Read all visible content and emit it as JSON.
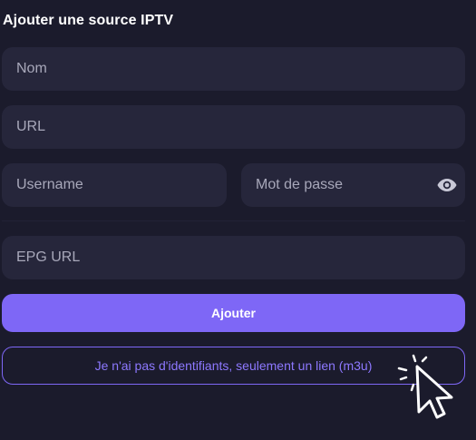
{
  "form": {
    "title": "Ajouter une source IPTV",
    "name_placeholder": "Nom",
    "url_placeholder": "URL",
    "username_placeholder": "Username",
    "password_placeholder": "Mot de passe",
    "epg_placeholder": "EPG URL",
    "submit_label": "Ajouter",
    "m3u_link_label": "Je n'ai pas d'identifiants, seulement un lien (m3u)"
  },
  "icons": {
    "password_toggle": "eye-icon",
    "pointer": "hand-pointer-click-icon"
  },
  "colors": {
    "background": "#1b1b2c",
    "field": "#26263b",
    "accent": "#7e67f6",
    "text": "#ffffff",
    "placeholder": "#a8a8ba"
  }
}
